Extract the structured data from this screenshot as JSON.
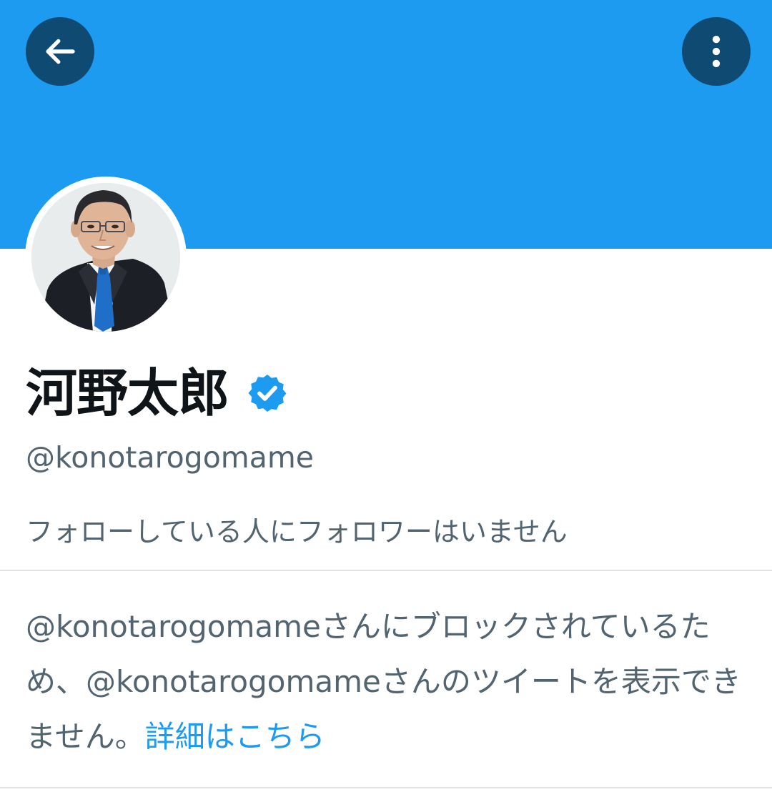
{
  "header": {
    "banner_color": "#1d9bf0",
    "back_icon": "arrow-left-icon",
    "more_icon": "more-vertical-icon"
  },
  "profile": {
    "avatar": "profile-photo",
    "display_name": "河野太郎",
    "verified_icon": "verified-badge-icon",
    "handle": "@konotarogomame",
    "followers_you_know": "フォローしている人にフォロワーはいません"
  },
  "blocked": {
    "message": "@konotarogomameさんにブロックされているため、@konotarogomameさんのツイートを表示できません。",
    "learn_more_link": "詳細はこちら"
  },
  "colors": {
    "accent": "#1d9bf0",
    "primary_text": "#0f1419",
    "secondary_text": "#536471"
  }
}
